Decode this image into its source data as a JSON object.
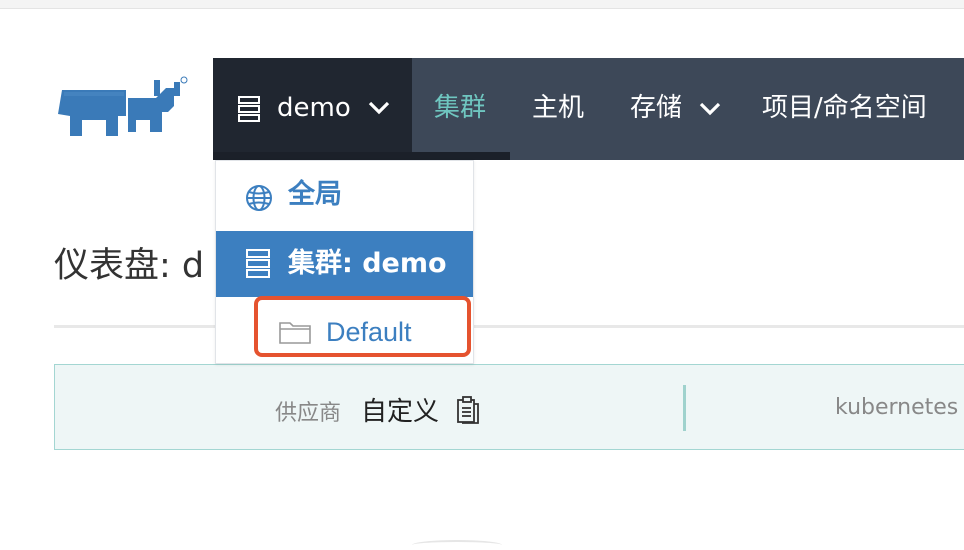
{
  "nav": {
    "scope_label": "demo",
    "items": [
      {
        "label": "集群",
        "active": true
      },
      {
        "label": "主机",
        "active": false
      },
      {
        "label": "存储",
        "active": false,
        "has_dropdown": true
      },
      {
        "label": "项目/命名空间",
        "active": false
      }
    ]
  },
  "dropdown": {
    "global_label": "全局",
    "cluster_label": "集群: demo",
    "project_label": "Default"
  },
  "page": {
    "title": "仪表盘: d"
  },
  "info": {
    "provider_key": "供应商",
    "provider_value": "自定义",
    "kubernetes_label": "kubernetes"
  },
  "colors": {
    "nav_bg": "#3d4858",
    "scope_bg": "#202630",
    "active_nav": "#6fc6c0",
    "accent": "#3c7fc0",
    "highlight": "#e5532f"
  }
}
